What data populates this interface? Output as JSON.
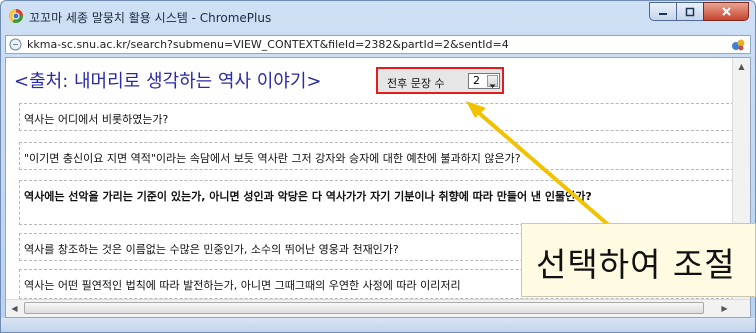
{
  "window": {
    "title": "꼬꼬마 세종 말뭉치 활용 시스템 - ChromePlus",
    "minimize_glyph": "—",
    "maximize_glyph": "▢",
    "close_glyph": "✕",
    "app_icon": "chromeplus-logo-icon"
  },
  "address_bar": {
    "url": "kkma-sc.snu.ac.kr/search?submenu=VIEW_CONTEXT&fileId=2382&partId=2&sentId=4",
    "left_icon": "page-icon",
    "right_icon": "extension-icon"
  },
  "page": {
    "heading": "<출처: 내머리로 생각하는 역사 이야기>",
    "context_control": {
      "label": "전후 문장 수",
      "selected_value": "2"
    },
    "sentences": [
      {
        "text": "역사는 어디에서 비롯하였는가?",
        "highlight": false
      },
      {
        "text": "\"이기면 충신이요 지면 역적\"이라는 속담에서 보듯 역사란 그저 강자와 승자에 대한 예찬에 불과하지 않은가?",
        "highlight": false
      },
      {
        "text": "역사에는 선악을 가리는 기준이 있는가, 아니면 성인과 악당은 다 역사가가 자기 기분이나 취향에 따라 만들어 낸 인물인가?",
        "highlight": true
      },
      {
        "text": "역사를 창조하는 것은 이름없는 수많은 민중인가, 소수의 뛰어난 영웅과 천재인가?",
        "highlight": false
      },
      {
        "text": "역사는 어떤 필연적인 법칙에 따라 발전하는가, 아니면 그때그때의 우연한 사정에 따라 이리저리",
        "highlight": false
      }
    ]
  },
  "annotation": {
    "callout_text": "선택하여 조절",
    "arrow_color": "#f2c200",
    "box_color": "#e01e1e"
  },
  "colors": {
    "heading": "#2a2aa8",
    "titlebar": "#c4d8f0"
  }
}
